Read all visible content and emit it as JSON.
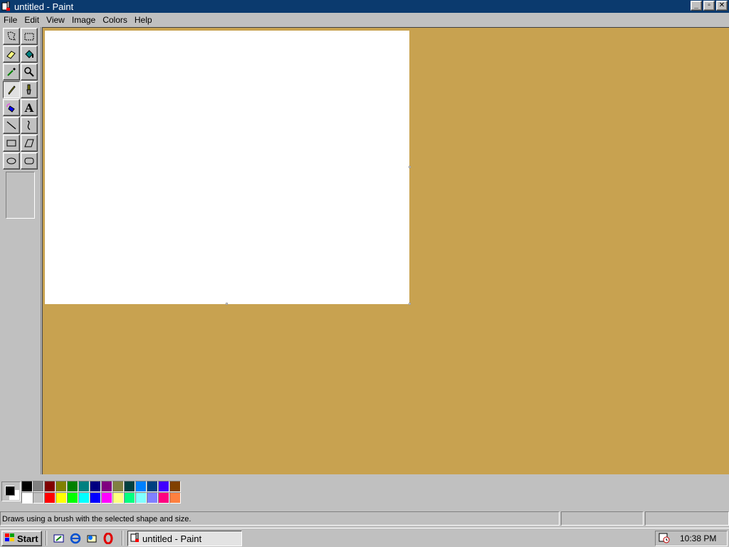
{
  "window": {
    "title": "untitled - Paint",
    "buttons": {
      "minimize": "_",
      "maximize": "▫",
      "close": "✕"
    }
  },
  "menu": [
    "File",
    "Edit",
    "View",
    "Image",
    "Colors",
    "Help"
  ],
  "toolbox": {
    "tools": [
      {
        "name": "free-form-select",
        "icon": "free-select-icon"
      },
      {
        "name": "select",
        "icon": "rect-select-icon"
      },
      {
        "name": "eraser",
        "icon": "eraser-icon"
      },
      {
        "name": "fill-with-color",
        "icon": "paint-bucket-icon"
      },
      {
        "name": "pick-color",
        "icon": "eyedropper-icon"
      },
      {
        "name": "magnifier",
        "icon": "magnifier-icon"
      },
      {
        "name": "pencil",
        "icon": "pencil-icon",
        "active": true
      },
      {
        "name": "brush",
        "icon": "brush-icon"
      },
      {
        "name": "airbrush",
        "icon": "airbrush-icon"
      },
      {
        "name": "text",
        "icon": "text-icon",
        "glyph": "A"
      },
      {
        "name": "line",
        "icon": "line-icon"
      },
      {
        "name": "curve",
        "icon": "curve-icon"
      },
      {
        "name": "rectangle",
        "icon": "rectangle-icon"
      },
      {
        "name": "polygon",
        "icon": "polygon-icon"
      },
      {
        "name": "ellipse",
        "icon": "ellipse-icon"
      },
      {
        "name": "rounded-rectangle",
        "icon": "rounded-rect-icon"
      }
    ]
  },
  "colors": {
    "workspace": "#c8a250",
    "canvas": "#ffffff",
    "titlebar": "#0b3a6e",
    "foreground": "#000000",
    "background": "#ffffff"
  },
  "palette": {
    "row1": [
      "#000000",
      "#808080",
      "#800000",
      "#808000",
      "#008000",
      "#008080",
      "#000080",
      "#800080",
      "#808040",
      "#004040",
      "#0080ff",
      "#004080",
      "#4000ff",
      "#804000"
    ],
    "row2": [
      "#ffffff",
      "#c0c0c0",
      "#ff0000",
      "#ffff00",
      "#00ff00",
      "#00ffff",
      "#0000ff",
      "#ff00ff",
      "#ffff80",
      "#00ff80",
      "#80ffff",
      "#8080ff",
      "#ff0080",
      "#ff8040"
    ]
  },
  "status": {
    "text": "Draws using a brush with the selected shape and size."
  },
  "taskbar": {
    "start_label": "Start",
    "task_label": "untitled - Paint",
    "clock": "10:38 PM"
  }
}
